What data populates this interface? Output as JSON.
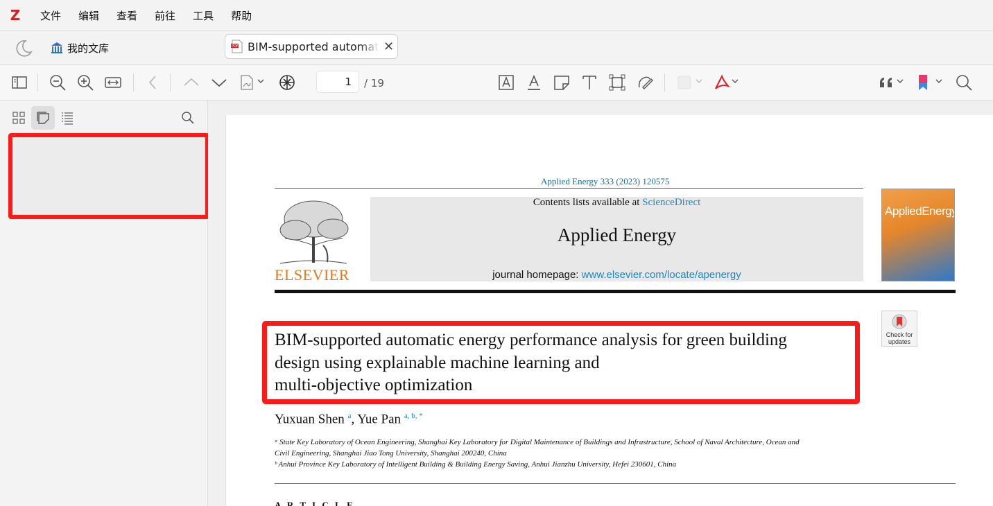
{
  "menu": {
    "logo": "Z",
    "items": [
      "文件",
      "编辑",
      "查看",
      "前往",
      "工具",
      "帮助"
    ]
  },
  "tabs": {
    "library_label": "我的文库",
    "document_title": "BIM-supported automatic energy performance analysis",
    "close_glyph": "✕"
  },
  "toolbar": {
    "current_page": "1",
    "total_pages": "/ 19"
  },
  "pdf": {
    "citation": "Applied Energy 333 (2023) 120575",
    "contents_prefix": "Contents lists available at ",
    "contents_link": "ScienceDirect",
    "journal_name": "Applied Energy",
    "homepage_prefix": "journal homepage: ",
    "homepage_link": "www.elsevier.com/locate/apenergy",
    "publisher": "ELSEVIER",
    "cover_title": "AppliedEnergy",
    "check_updates": "Check for updates",
    "title_lines": [
      "BIM-supported automatic energy performance analysis for green building",
      "design using explainable machine learning and",
      "multi-objective optimization"
    ],
    "author1": "Yuxuan Shen",
    "author1_sup": "a",
    "author_sep": ", ",
    "author2": "Yue Pan",
    "author2_sup": "a, b, *",
    "affiliations": [
      "ᵃ State Key Laboratory of Ocean Engineering, Shanghai Key Laboratory for Digital Maintenance of Buildings and Infrastructure, School of Naval Architecture, Ocean and",
      "Civil Engineering, Shanghai Jiao Tong University, Shanghai 200240, China",
      "ᵇ Anhui Province Key Laboratory of Intelligent Building & Building Energy Saving, Anhui Jianzhu University, Hefei 230601, China"
    ],
    "section_peek": "A R T I C L E"
  },
  "colors": {
    "accent_red": "#ff1a1a",
    "link_blue": "#1f86c7",
    "zotero_red": "#d61f1f"
  }
}
